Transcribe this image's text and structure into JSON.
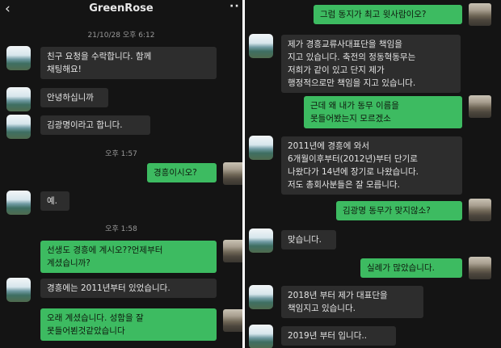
{
  "left": {
    "header": {
      "back_icon": "‹",
      "title": "GreenRose",
      "more_icon": "··"
    },
    "stamps": {
      "date": "21/10/28 오후 6:12",
      "t1": "오후 1:57",
      "t2": "오후 1:58"
    },
    "messages": [
      {
        "from": "other",
        "text": "친구 요청을 수락합니다. 함께\n채팅해요!"
      },
      {
        "from": "other",
        "text": "안녕하십니까"
      },
      {
        "from": "other",
        "text": "김광명이라고 합니다."
      },
      {
        "from": "me",
        "text": "경흥이시오?"
      },
      {
        "from": "other",
        "text": "예."
      },
      {
        "from": "me",
        "text": "선생도 경흥에 계시오??언제부터\n계셨습니까?"
      },
      {
        "from": "other",
        "text": "경흥에는 2011년부터 있었습니다."
      },
      {
        "from": "me",
        "text": "오래 계셨습니다. 성함을 잘\n못들어뵌것같았습니다"
      }
    ]
  },
  "right": {
    "messages": [
      {
        "from": "me",
        "text": "그럼 동지가 최고 윗사람이오?"
      },
      {
        "from": "other",
        "text": "제가 경흥교류사대표단을 책임을\n지고 있습니다. 축전의 정동혁동무는\n저희가 같이 있고 단지 제가\n행정적으로만 책임을 지고 있습니다."
      },
      {
        "from": "me",
        "text": "근데 왜 내가 동무 이름을\n못들어봤는지 모르겠소"
      },
      {
        "from": "other",
        "text": "2011년에 경흥에 와서\n6개월이후부터(2012년)부터 단기로\n나왔다가 14년에 장기로 나왔습니다.\n저도 총회사분들은 잘 모릅니다."
      },
      {
        "from": "me",
        "text": "김광명 동무가 맞지않소?"
      },
      {
        "from": "other",
        "text": "맞습니다."
      },
      {
        "from": "me",
        "text": "실례가 많았습니다."
      },
      {
        "from": "other",
        "text": "2018년 부터 제가 대표단을\n책임지고 있습니다."
      },
      {
        "from": "other",
        "text": "2019년 부터 입니다.."
      }
    ]
  }
}
